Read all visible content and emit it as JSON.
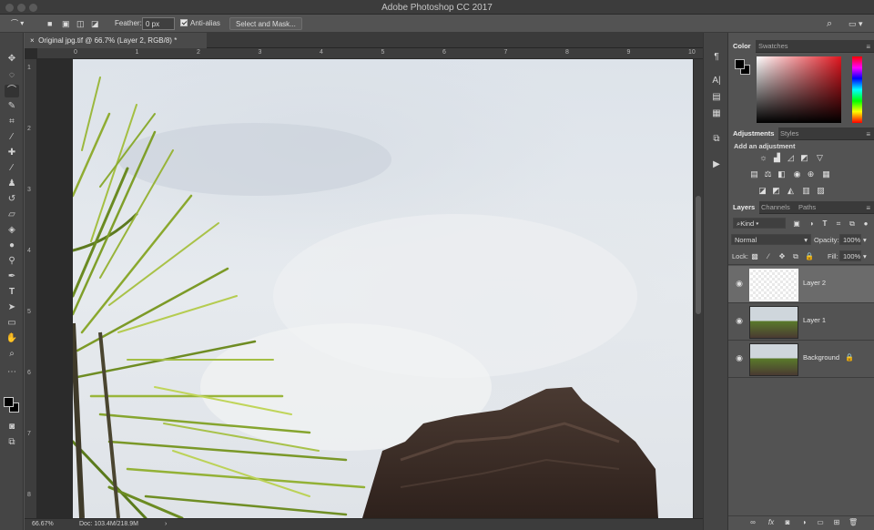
{
  "window": {
    "title": "Adobe Photoshop CC 2017"
  },
  "options": {
    "feather_label": "Feather:",
    "feather_value": "0 px",
    "antialias_label": "Anti-alias",
    "select_mask_label": "Select and Mask..."
  },
  "document": {
    "tab_title": "Original jpg.tif @ 66.7% (Layer 2, RGB/8) *",
    "ruler_h": [
      "0",
      "1",
      "2",
      "3",
      "4",
      "5",
      "6",
      "7",
      "8",
      "9",
      "10"
    ],
    "ruler_v": [
      "1",
      "2",
      "3",
      "4",
      "5",
      "6",
      "7",
      "8"
    ],
    "zoom": "66.67%",
    "doc_info": "Doc: 103.4M/218.9M"
  },
  "color_panel": {
    "tabs": [
      "Color",
      "Swatches"
    ],
    "hue_color": "#e0161f"
  },
  "adjustments_panel": {
    "tabs": [
      "Adjustments",
      "Styles"
    ],
    "heading": "Add an adjustment"
  },
  "layers_panel": {
    "tabs": [
      "Layers",
      "Channels",
      "Paths"
    ],
    "filter_kind": "Kind",
    "blend_mode": "Normal",
    "opacity_label": "Opacity:",
    "opacity_value": "100%",
    "lock_label": "Lock:",
    "fill_label": "Fill:",
    "fill_value": "100%",
    "layers": [
      {
        "name": "Layer 2"
      },
      {
        "name": "Layer 1"
      },
      {
        "name": "Background"
      }
    ]
  }
}
